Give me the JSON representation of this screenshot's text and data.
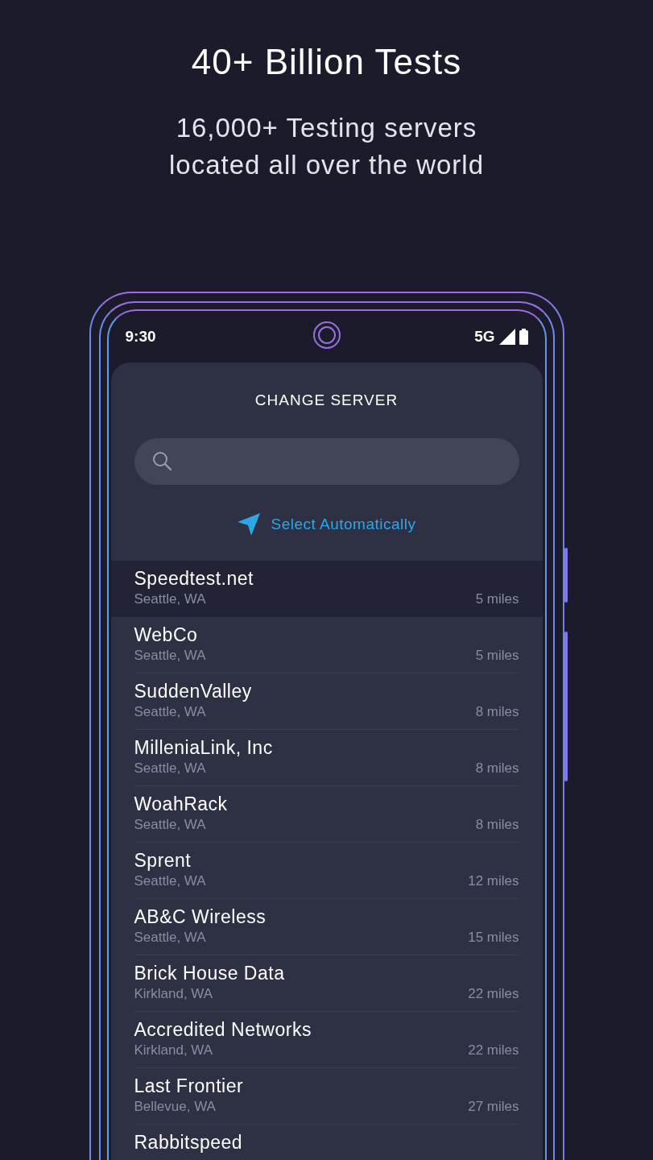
{
  "headline": "40+ Billion Tests",
  "subtitle": [
    "16,000+ Testing servers",
    "located all over the world"
  ],
  "status_bar": {
    "time": "9:30",
    "network": "5G"
  },
  "sheet": {
    "title": "CHANGE SERVER",
    "auto_select": "Select Automatically",
    "servers": [
      {
        "name": "Speedtest.net",
        "city": "Seattle, WA",
        "distance": "5 miles",
        "selected": true
      },
      {
        "name": "WebCo",
        "city": "Seattle, WA",
        "distance": "5 miles",
        "selected": false
      },
      {
        "name": "SuddenValley",
        "city": "Seattle, WA",
        "distance": "8 miles",
        "selected": false
      },
      {
        "name": "MilleniaLink, Inc",
        "city": "Seattle, WA",
        "distance": "8 miles",
        "selected": false
      },
      {
        "name": "WoahRack",
        "city": "Seattle, WA",
        "distance": "8 miles",
        "selected": false
      },
      {
        "name": "Sprent",
        "city": "Seattle, WA",
        "distance": "12 miles",
        "selected": false
      },
      {
        "name": "AB&C Wireless",
        "city": "Seattle, WA",
        "distance": "15 miles",
        "selected": false
      },
      {
        "name": "Brick House Data",
        "city": "Kirkland, WA",
        "distance": "22 miles",
        "selected": false
      },
      {
        "name": "Accredited Networks",
        "city": "Kirkland, WA",
        "distance": "22 miles",
        "selected": false
      },
      {
        "name": "Last Frontier",
        "city": "Bellevue, WA",
        "distance": "27 miles",
        "selected": false
      },
      {
        "name": "Rabbitspeed",
        "selected": false
      }
    ]
  }
}
